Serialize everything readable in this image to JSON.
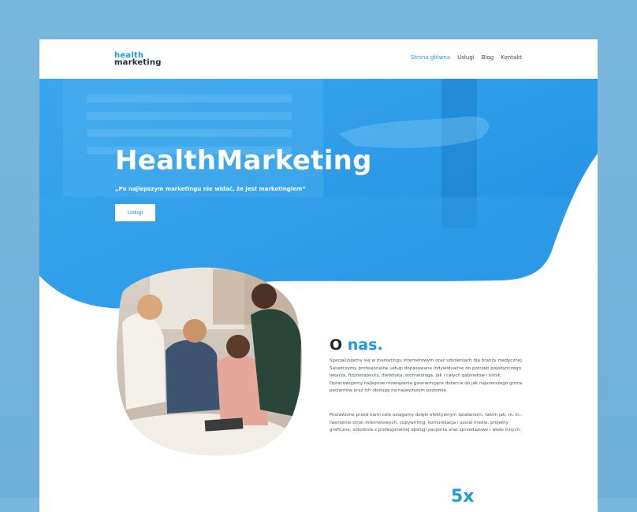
{
  "header": {
    "logo": {
      "line1": "health",
      "line2": "marketing"
    },
    "nav": [
      {
        "label": "Strona główna",
        "active": true
      },
      {
        "label": "Usługi",
        "active": false
      },
      {
        "label": "Blog",
        "active": false
      },
      {
        "label": "Kontakt",
        "active": false
      }
    ]
  },
  "hero": {
    "title": "HealthMarketing",
    "quote": "„Po najlepszym marketingu nie widać, że jest marketingiem”",
    "button_label": "Usługi"
  },
  "about": {
    "heading": "O",
    "heading_accent": "nas.",
    "paragraph1": "Specjalizujemy się w marketingu internetowym oraz szkoleniach dla branży medycznej. Świadczymy profesjonalne usługi dopasowane indywidualnie do potrzeb pojedynczego lekarza, fizjoterapeuty, dietetyka, stomatologa, jak i całych gabinetów i klinik. Opracowujemy najlepsze rozwiązania gwarantujące dotarcie do jak najszerszego grona pacjentów oraz ich obsługę na najwyższym poziomie.",
    "paragraph2": "Postawione przed nami cele osiągamy dzięki efektywnym działaniom, takim jak, m. in.: tworzenie stron internetowych, copywriting, komunikacja i social media, projekty graficzne, szkolenia z profesjonalnej obsługi pacjenta oraz sprzedażowe i wiele innych."
  },
  "stat": {
    "value": "5x"
  },
  "colors": {
    "accent": "#1e9be0",
    "hero": "#2b9ce6",
    "text_dark": "#1f2a36",
    "background": "#79b7dd"
  }
}
